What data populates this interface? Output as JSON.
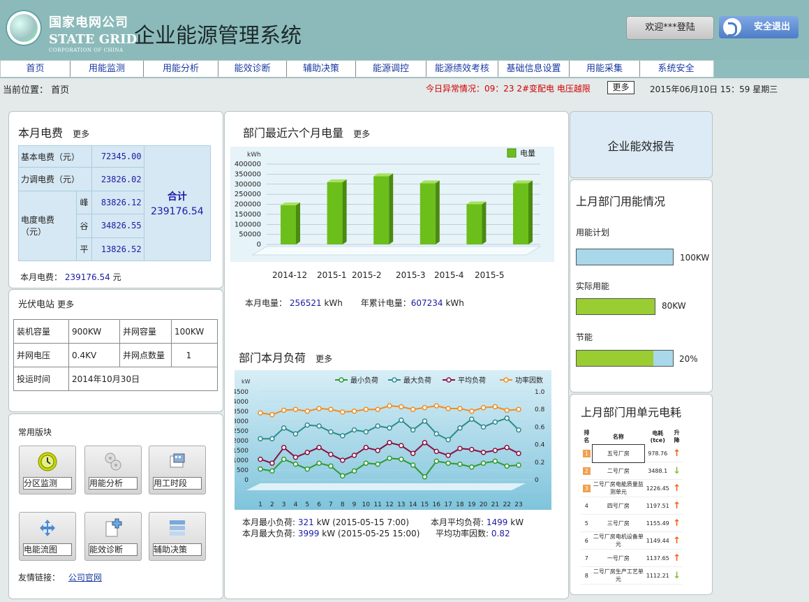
{
  "brand": {
    "cn": "国家电网公司",
    "en": "STATE GRID",
    "en_sub": "CORPORATION OF CHINA"
  },
  "app_title": "企业能源管理系统",
  "header": {
    "welcome": "欢迎***登陆",
    "logout": "安全退出"
  },
  "nav": [
    {
      "label": "首页"
    },
    {
      "label": "用能监测"
    },
    {
      "label": "用能分析"
    },
    {
      "label": "能效诊断"
    },
    {
      "label": "辅助决策"
    },
    {
      "label": "能源调控"
    },
    {
      "label": "能源绩效考核"
    },
    {
      "label": "基础信息设置"
    },
    {
      "label": "用能采集"
    },
    {
      "label": "系统安全"
    }
  ],
  "breadcrumb": {
    "label": "当前位置：",
    "value": "首页"
  },
  "alert": "今日异常情况：09：23  2#变配电 电压越限",
  "alert_more": "更多",
  "datetime": "2015年06月10日  15：59  星期三",
  "more_label": "更多",
  "bill": {
    "title": "本月电费",
    "rows": [
      {
        "label": "基本电费（元）",
        "value": "72345.00"
      },
      {
        "label": "力调电费（元）",
        "value": "23826.02"
      }
    ],
    "degree_label": "电度电费（元）",
    "degree_rows": [
      {
        "sub": "峰",
        "value": "83826.12"
      },
      {
        "sub": "谷",
        "value": "34826.55"
      },
      {
        "sub": "平",
        "value": "13826.52"
      }
    ],
    "total_label": "合计",
    "total_value": "239176.54",
    "footer_label": "本月电费：",
    "footer_value": "239176.54",
    "footer_unit": "元"
  },
  "pv": {
    "title": "光伏电站",
    "rows": [
      [
        "装机容量",
        "900KW",
        "并网容量",
        "100KW"
      ],
      [
        "并网电压",
        "0.4KV",
        "并网点数量",
        "1"
      ]
    ],
    "date_label": "投运时间",
    "date_value": "2014年10月30日"
  },
  "modules": {
    "title": "常用版块",
    "items": [
      {
        "label": "分区监测",
        "icon": "clock-icon"
      },
      {
        "label": "用能分析",
        "icon": "gears-icon"
      },
      {
        "label": "用工时段",
        "icon": "calendar-icon"
      },
      {
        "label": "电能流图",
        "icon": "flow-arrows-icon"
      },
      {
        "label": "能效诊断",
        "icon": "document-plus-icon"
      },
      {
        "label": "辅助决策",
        "icon": "list-icon"
      }
    ],
    "friend_label": "友情链接：",
    "friend_link": "公司官网"
  },
  "dept_energy": {
    "title": "部门最近六个月电量",
    "footer": {
      "month_label": "本月电量：",
      "month_value": "256521",
      "unit": "kWh",
      "year_label": "年累计电量：",
      "year_value": "607234"
    }
  },
  "dept_load": {
    "title": "部门本月负荷",
    "stats": {
      "min_label": "本月最小负荷:",
      "min_value": "321",
      "min_rest": "kW  (2015-05-15 7:00)",
      "max_label": "本月最大负荷:",
      "max_value": "3999",
      "max_rest": "kW (2015-05-25 15:00)",
      "avg_label": "本月平均负荷:",
      "avg_value": "1499",
      "avg_unit": "kW",
      "pf_label": "平均功率因数:",
      "pf_value": "0.82"
    }
  },
  "report": {
    "title": "企业能效报告"
  },
  "usage": {
    "title": "上月部门用能情况",
    "items": [
      {
        "label": "用能计划",
        "value": "100KW",
        "fill": 1.0,
        "color": "#a8d8ea"
      },
      {
        "label": "实际用能",
        "value": "80KW",
        "fill": 1.0,
        "color": "#9acd32"
      },
      {
        "label": "节能",
        "value": "20%",
        "fill": 0.8,
        "color": "#9acd32"
      }
    ]
  },
  "unit_consumption": {
    "title": "上月部门用单元电耗",
    "headers": [
      "排名",
      "名称",
      "电耗(tce)",
      "升降"
    ],
    "rows": [
      {
        "rank": "1",
        "name": "五号厂房",
        "value": "978.76",
        "trend": "up"
      },
      {
        "rank": "2",
        "name": "二号厂房",
        "value": "3488.1",
        "trend": "down"
      },
      {
        "rank": "3",
        "name": "二号厂房电能质量监测单元",
        "value": "1226.45",
        "trend": "up"
      },
      {
        "rank": "4",
        "name": "四号厂房",
        "value": "1197.51",
        "trend": "up"
      },
      {
        "rank": "5",
        "name": "三号厂房",
        "value": "1155.49",
        "trend": "up"
      },
      {
        "rank": "6",
        "name": "二号厂房电机设备单元",
        "value": "1149.44",
        "trend": "up"
      },
      {
        "rank": "7",
        "name": "一号厂房",
        "value": "1137.65",
        "trend": "up"
      },
      {
        "rank": "8",
        "name": "二号厂房生产工艺单元",
        "value": "1112.21",
        "trend": "down"
      }
    ]
  },
  "chart_data": [
    {
      "type": "bar",
      "ylabel": "kWh",
      "legend": "电量",
      "categories": [
        "2014-12",
        "2015-1",
        "2015-2",
        "2015-3",
        "2015-4",
        "2015-5"
      ],
      "series": [
        {
          "name": "电量",
          "values": [
            195000,
            310000,
            340000,
            305000,
            200000,
            305000
          ]
        }
      ],
      "yticks": [
        0,
        50000,
        100000,
        150000,
        200000,
        250000,
        300000,
        350000,
        400000
      ],
      "ylim": [
        0,
        400000
      ],
      "color": "#6cbf1a"
    },
    {
      "type": "line",
      "ylabel": "kW",
      "x": [
        1,
        2,
        3,
        4,
        5,
        6,
        7,
        8,
        9,
        10,
        11,
        12,
        13,
        14,
        15,
        16,
        17,
        18,
        19,
        20,
        21,
        22,
        23
      ],
      "yticks_left": [
        0,
        500,
        1000,
        1500,
        2000,
        2500,
        3000,
        3500,
        4000,
        4500
      ],
      "yticks_right": [
        "0",
        "0.2",
        "0.4",
        "0.6",
        "0.8",
        "1.0"
      ],
      "ylim": [
        0,
        4500
      ],
      "ylim_right": [
        0,
        1.0
      ],
      "series": [
        {
          "name": "最小负荷",
          "color": "#2e9a2e",
          "axis": "left",
          "values": [
            550,
            450,
            1050,
            800,
            550,
            850,
            700,
            200,
            450,
            850,
            800,
            1100,
            1050,
            750,
            150,
            950,
            850,
            800,
            650,
            850,
            950,
            700,
            750
          ]
        },
        {
          "name": "最大负荷",
          "color": "#2a8a8a",
          "axis": "left",
          "values": [
            2100,
            2100,
            2650,
            2350,
            2800,
            2750,
            2450,
            2250,
            2550,
            2450,
            2750,
            2650,
            3050,
            2550,
            3000,
            2350,
            2050,
            2650,
            3100,
            2700,
            2950,
            3150,
            2550
          ]
        },
        {
          "name": "平均负荷",
          "color": "#8a1040",
          "axis": "left",
          "values": [
            1050,
            850,
            1650,
            1150,
            1400,
            1650,
            1300,
            1000,
            1250,
            1650,
            1500,
            1900,
            1750,
            1350,
            1900,
            1450,
            1250,
            1600,
            1550,
            1400,
            1500,
            1650,
            1350
          ]
        },
        {
          "name": "功率因数",
          "color": "#f08c20",
          "axis": "right",
          "values": [
            0.76,
            0.74,
            0.79,
            0.8,
            0.78,
            0.81,
            0.8,
            0.77,
            0.78,
            0.8,
            0.8,
            0.84,
            0.83,
            0.8,
            0.82,
            0.84,
            0.81,
            0.81,
            0.78,
            0.82,
            0.83,
            0.79,
            0.8
          ]
        }
      ]
    }
  ]
}
